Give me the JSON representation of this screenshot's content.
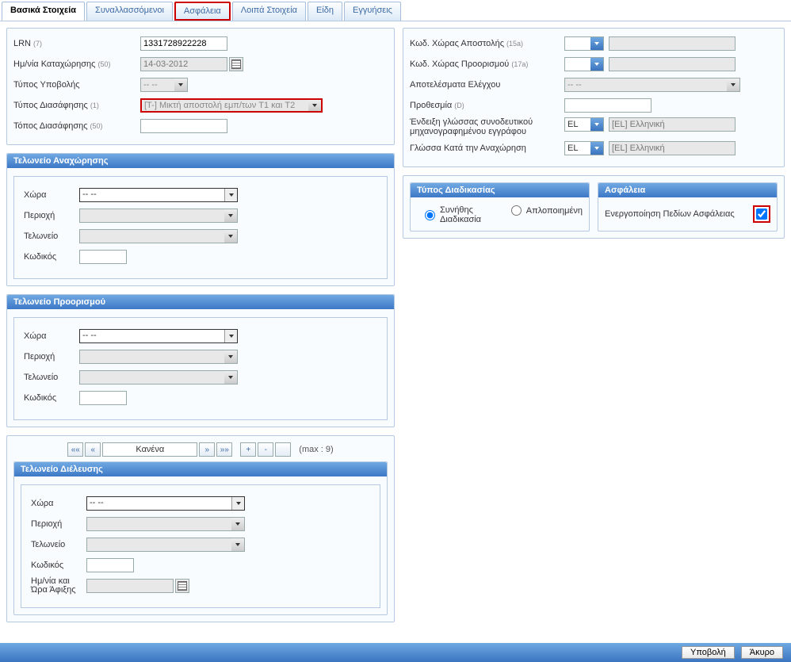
{
  "tabs": {
    "basic": "Βασικά Στοιχεία",
    "parties": "Συναλλασσόμενοι",
    "security": "Ασφάλεια",
    "other": "Λοιπά Στοιχεία",
    "items": "Είδη",
    "guarantees": "Εγγυήσεις"
  },
  "left": {
    "lrn_label": "LRN",
    "lrn_code": "(7)",
    "lrn_value": "1331728922228",
    "regdate_label": "Ημ/νία Καταχώρησης",
    "regdate_code": "(50)",
    "regdate_value": "14-03-2012",
    "subtype_label": "Τύπος Υποβολής",
    "subtype_value": "-- --",
    "decltype_label": "Τύπος Διασάφησης",
    "decltype_code": "(1)",
    "decltype_value": "[T-] Μικτή αποστολή εμπ/των T1 και T2",
    "declplace_label": "Τόπος Διασάφησης",
    "declplace_code": "(50)",
    "declplace_value": ""
  },
  "officeFields": {
    "country": "Χώρα",
    "region": "Περιοχή",
    "customs": "Τελωνείο",
    "code": "Κωδικός",
    "arrival_dt": "Ημ/νία και Ώρα Άφιξης",
    "country_value": "-- --"
  },
  "panels": {
    "departure": "Τελωνείο Αναχώρησης",
    "destination": "Τελωνείο Προορισμού",
    "transit": "Τελωνείο Διέλευσης",
    "procedure": "Τύπος Διαδικασίας",
    "security": "Ασφάλεια"
  },
  "nav": {
    "first": "««",
    "prev": "«",
    "text": "Κανένα",
    "next": "»",
    "last": "»»",
    "max": "(max : 9)"
  },
  "right": {
    "dispatch_label": "Κωδ. Χώρας Αποστολής",
    "dispatch_code": "(15a)",
    "dest_label": "Κωδ. Χώρας Προορισμού",
    "dest_code": "(17a)",
    "control_label": "Αποτελέσματα Ελέγχου",
    "control_value": "-- --",
    "deadline_label": "Προθεσμία",
    "deadline_code": "(D)",
    "doclang_label": "Ένδειξη γλώσσας συνοδευτικού μηχανογραφημένου εγγράφου",
    "deptlang_label": "Γλώσσα Κατά την Αναχώρηση",
    "lang_code": "EL",
    "lang_name": "[EL] Ελληνική"
  },
  "procedure": {
    "normal": "Συνήθης Διαδικασία",
    "simplified": "Απλοποιημένη"
  },
  "security": {
    "checkbox_label": "Ενεργοποίηση Πεδίων Ασφάλειας"
  },
  "footer": {
    "submit": "Υποβολή",
    "cancel": "Άκυρο"
  }
}
